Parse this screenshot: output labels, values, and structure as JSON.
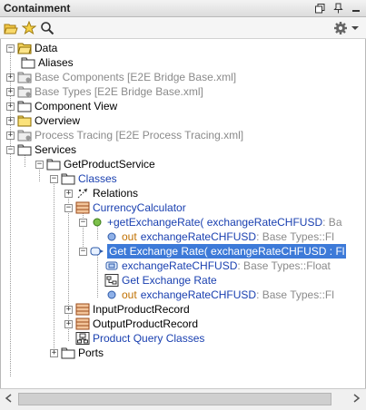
{
  "window": {
    "title": "Containment"
  },
  "tree": {
    "nodes": [
      {
        "label": "Data",
        "style": "normal"
      },
      {
        "label": "Aliases",
        "style": "normal"
      },
      {
        "label": "Base Components [E2E Bridge Base.xml]",
        "style": "grey"
      },
      {
        "label": "Base Types [E2E Bridge Base.xml]",
        "style": "grey"
      },
      {
        "label": "Component View",
        "style": "normal"
      },
      {
        "label": "Overview",
        "style": "normal"
      },
      {
        "label": "Process Tracing [E2E Process Tracing.xml]",
        "style": "grey"
      },
      {
        "label": "Services",
        "style": "normal"
      },
      {
        "label": "GetProductService",
        "style": "normal"
      },
      {
        "label": "Classes",
        "style": "blue"
      },
      {
        "label": "Relations",
        "style": "normal"
      },
      {
        "label": "CurrencyCalculator",
        "style": "blue"
      },
      {
        "label": "+getExchangeRate( exchangeRateCHFUSD",
        "suffix": " : Ba",
        "style": "blue"
      },
      {
        "prefix": "out",
        "label": "exchangeRateCHFUSD",
        "suffix": " : Base Types::Fl",
        "style": "blue"
      },
      {
        "label": "Get Exchange Rate( exchangeRateCHFUSD : Fl",
        "style": "selected"
      },
      {
        "label": "exchangeRateCHFUSD",
        "suffix": " : Base Types::Float",
        "style": "blue"
      },
      {
        "label": "Get Exchange Rate",
        "style": "blue"
      },
      {
        "prefix": "out",
        "label": "exchangeRateCHFUSD",
        "suffix": " : Base Types::Fl",
        "style": "blue"
      },
      {
        "label": "InputProductRecord",
        "style": "normal"
      },
      {
        "label": "OutputProductRecord",
        "style": "normal"
      },
      {
        "label": "Product Query Classes",
        "style": "blue"
      },
      {
        "label": "Ports",
        "style": "normal"
      }
    ]
  }
}
